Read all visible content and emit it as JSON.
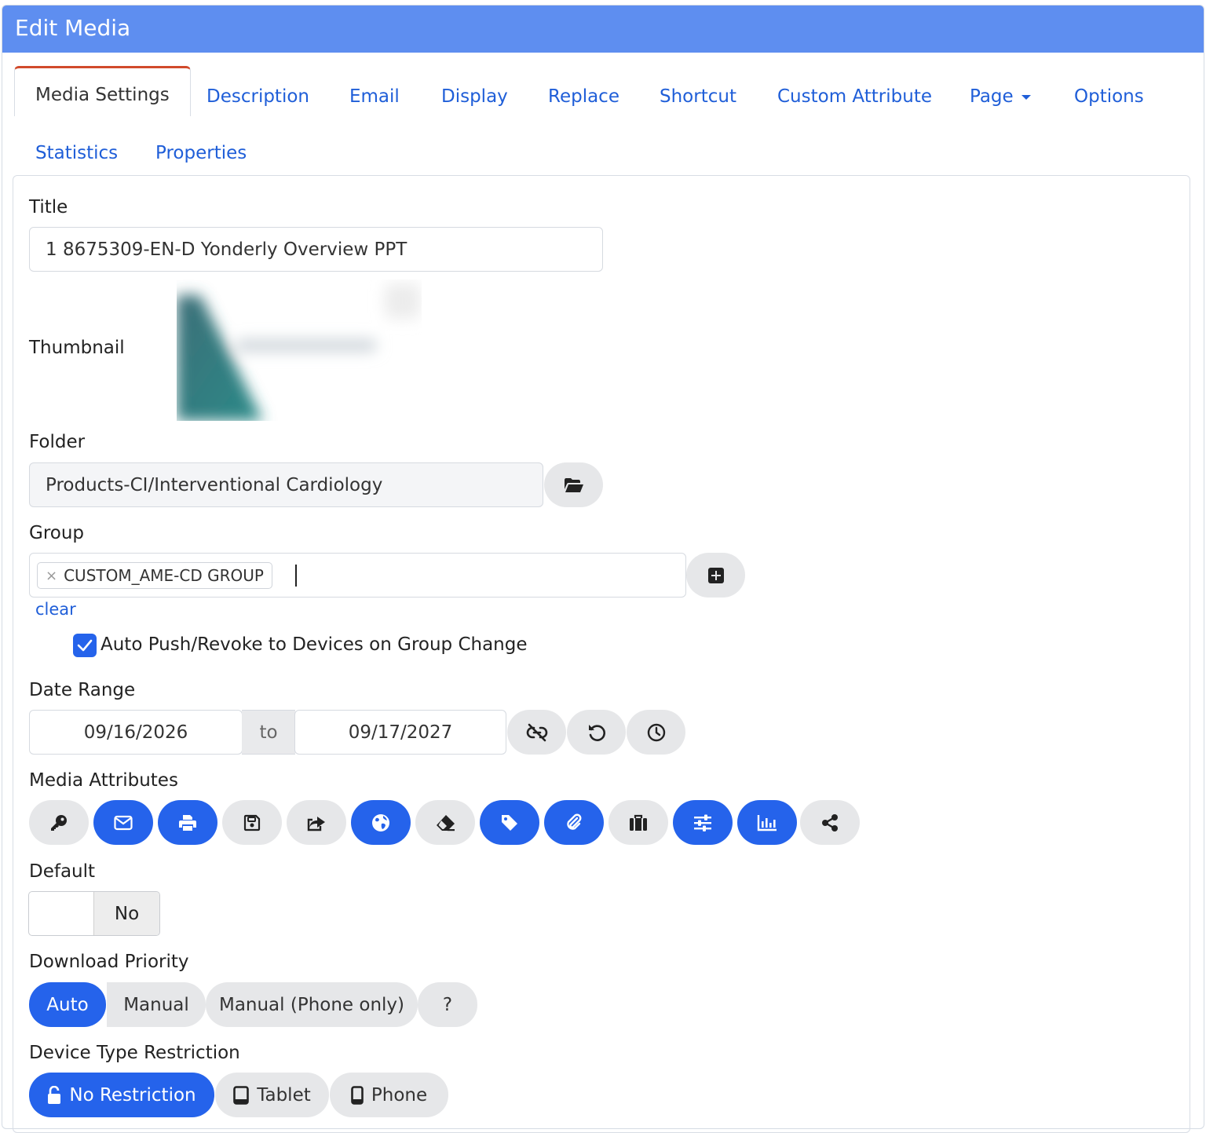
{
  "dialog": {
    "title": "Edit Media"
  },
  "tabs": {
    "media_settings": "Media Settings",
    "description": "Description",
    "email": "Email",
    "display": "Display",
    "replace": "Replace",
    "shortcut": "Shortcut",
    "custom_attribute": "Custom Attribute",
    "page": "Page",
    "options": "Options",
    "statistics": "Statistics",
    "properties": "Properties"
  },
  "form": {
    "title_label": "Title",
    "title_value": "1 8675309-EN-D Yonderly Overview PPT",
    "thumbnail_label": "Thumbnail",
    "folder_label": "Folder",
    "folder_value": "Products-CI/Interventional Cardiology",
    "group_label": "Group",
    "group_tag": "CUSTOM_AME-CD GROUP",
    "group_tag_remove": "×",
    "clear_link": "clear",
    "auto_push_label": "Auto Push/Revoke to Devices on Group Change",
    "auto_push_checked": true,
    "date_range_label": "Date Range",
    "date_start": "09/16/2026",
    "date_to": "to",
    "date_end": "09/17/2027",
    "media_attributes_label": "Media Attributes",
    "media_attributes": [
      {
        "icon": "key-icon",
        "active": false
      },
      {
        "icon": "envelope-icon",
        "active": true
      },
      {
        "icon": "print-icon",
        "active": true
      },
      {
        "icon": "save-icon",
        "active": false
      },
      {
        "icon": "share-square-icon",
        "active": false
      },
      {
        "icon": "globe-icon",
        "active": true
      },
      {
        "icon": "eraser-icon",
        "active": false
      },
      {
        "icon": "tag-icon",
        "active": true
      },
      {
        "icon": "paperclip-icon",
        "active": true
      },
      {
        "icon": "suitcase-icon",
        "active": false
      },
      {
        "icon": "sliders-icon",
        "active": true
      },
      {
        "icon": "chart-icon",
        "active": true
      },
      {
        "icon": "share-nodes-icon",
        "active": false
      }
    ],
    "default_label": "Default",
    "default_value": "No",
    "download_priority_label": "Download Priority",
    "download_priority_options": [
      "Auto",
      "Manual",
      "Manual (Phone only)"
    ],
    "download_priority_selected": "Auto",
    "help_button": "?",
    "device_restriction_label": "Device Type Restriction",
    "device_options": [
      "No Restriction",
      "Tablet",
      "Phone"
    ],
    "device_selected": "No Restriction"
  },
  "colors": {
    "header": "#5e8ef0",
    "accent_blue": "#2563eb",
    "link_blue": "#1f5ed8",
    "active_tab_border": "#d14a2b",
    "button_gray": "#e6e7e9"
  }
}
